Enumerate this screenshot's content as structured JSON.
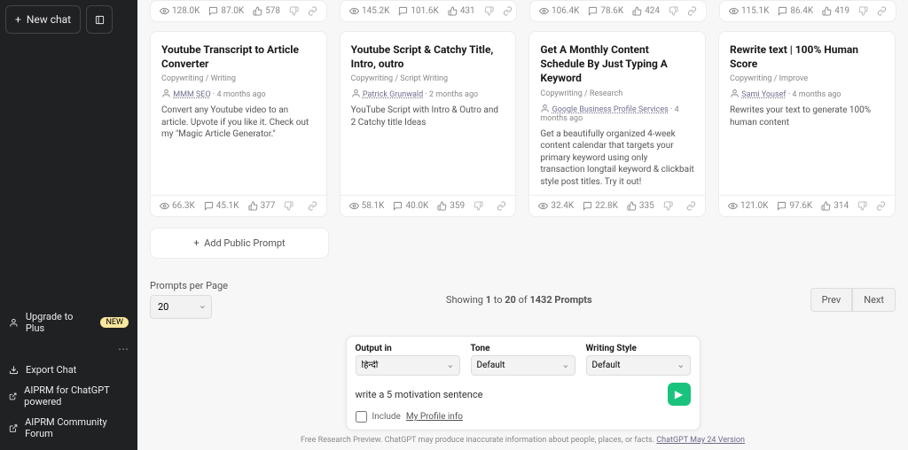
{
  "sidebar": {
    "new_chat": "New chat",
    "upgrade": "Upgrade to Plus",
    "badge_new": "NEW",
    "items": [
      {
        "label": "Export Chat"
      },
      {
        "label": "AIPRM for ChatGPT powered"
      },
      {
        "label": "AIPRM Community Forum"
      }
    ]
  },
  "top_stats": [
    {
      "views": "128.0K",
      "comments": "87.0K",
      "likes": "578"
    },
    {
      "views": "145.2K",
      "comments": "101.6K",
      "likes": "431"
    },
    {
      "views": "106.4K",
      "comments": "78.6K",
      "likes": "424"
    },
    {
      "views": "115.1K",
      "comments": "86.4K",
      "likes": "419"
    }
  ],
  "cards": [
    {
      "title": "Youtube Transcript to Article Converter",
      "category": "Copywriting / Writing",
      "author": "MMM SEO",
      "time": "4 months ago",
      "desc": "Convert any Youtube video to an article. Upvote if you like it. Check out my \"Magic Article Generator.\"",
      "views": "66.3K",
      "comments": "45.1K",
      "likes": "377"
    },
    {
      "title": "Youtube Script & Catchy Title, Intro, outro",
      "category": "Copywriting / Script Writing",
      "author": "Patrick Grunwald",
      "time": "2 months ago",
      "desc": "YouTube Script with Intro & Outro and 2 Catchy title Ideas",
      "views": "58.1K",
      "comments": "40.0K",
      "likes": "359"
    },
    {
      "title": "Get A Monthly Content Schedule By Just Typing A Keyword",
      "category": "Copywriting / Research",
      "author": "Google Business Profile Services",
      "time": "4 months ago",
      "desc": "Get a beautifully organized 4-week content calendar that targets your primary keyword using only transaction longtail keyword & clickbait style post titles. Try it out!",
      "views": "32.4K",
      "comments": "22.8K",
      "likes": "335"
    },
    {
      "title": "Rewrite text | 100% Human Score",
      "category": "Copywriting / Improve",
      "author": "Sami Yousef",
      "time": "4 months ago",
      "desc": "Rewrites your text to generate 100% human content",
      "views": "121.0K",
      "comments": "97.6K",
      "likes": "314"
    }
  ],
  "add_prompt": "Add Public Prompt",
  "ppp_label": "Prompts per Page",
  "ppp_value": "20",
  "showing": {
    "a": "Showing ",
    "b": "1",
    "c": " to ",
    "d": "20",
    "e": " of ",
    "f": "1432 Prompts"
  },
  "prev": "Prev",
  "next": "Next",
  "composer": {
    "output_label": "Output in",
    "output_value": "हिन्दी",
    "tone_label": "Tone",
    "tone_value": "Default",
    "style_label": "Writing Style",
    "style_value": "Default",
    "prompt_value": "write a 5 motivation sentence",
    "include": "Include",
    "profile_link": "My Profile info"
  },
  "disclaimer": {
    "a": "Free Research Preview. ChatGPT may produce inaccurate information about people, places, or facts. ",
    "b": "ChatGPT May 24 Version"
  }
}
